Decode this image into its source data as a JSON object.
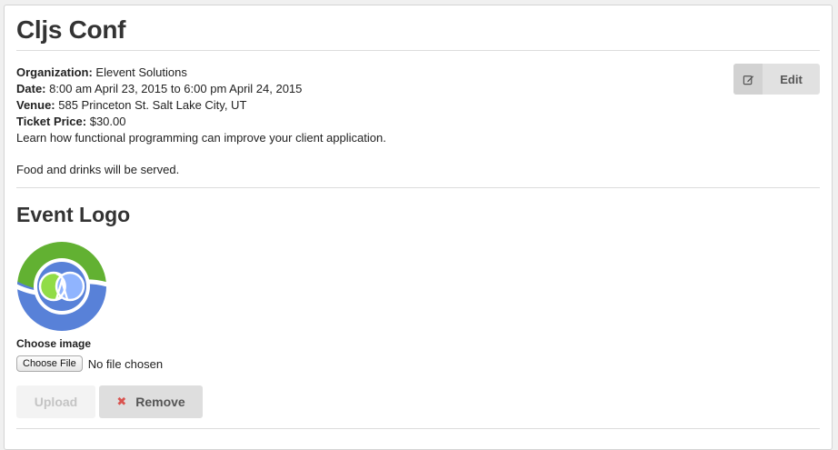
{
  "event": {
    "title": "Cljs Conf",
    "organization_label": "Organization:",
    "organization": "Elevent Solutions",
    "date_label": "Date:",
    "date": "8:00 am April 23, 2015 to 6:00 pm April 24, 2015",
    "venue_label": "Venue:",
    "venue": "585 Princeton St. Salt Lake City, UT",
    "price_label": "Ticket Price:",
    "price": "$30.00",
    "description_1": "Learn how functional programming can improve your client application.",
    "description_2": "Food and drinks will be served."
  },
  "actions": {
    "edit_label": "Edit",
    "edit_icon": "edit-icon"
  },
  "logo_section": {
    "heading": "Event Logo",
    "choose_label": "Choose image",
    "file_button": "Choose File",
    "file_status": "No file chosen",
    "upload_label": "Upload",
    "remove_label": "Remove",
    "remove_icon": "close-icon",
    "logo_colors": {
      "green": "#62b132",
      "blue": "#5881d8",
      "light_blue": "#90b4fe",
      "light_green": "#91dc47"
    }
  }
}
